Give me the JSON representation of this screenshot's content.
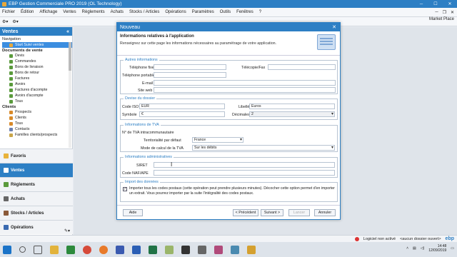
{
  "app": {
    "title": "EBP Gestion Commerciale PRO 2019 (OL Technology)",
    "market": "Market Place"
  },
  "menu": [
    "Fichier",
    "Édition",
    "Affichage",
    "Ventes",
    "Règlements",
    "Achats",
    "Stocks / Articles",
    "Opérations",
    "Paramètres",
    "Outils",
    "Fenêtres",
    "?"
  ],
  "sidebar": {
    "header": "Ventes",
    "navigation_label": "Navigation",
    "selected": "Start Suivi ventes",
    "group1": "Documents de vente",
    "docs": [
      "Devis",
      "Commandes",
      "Bons de livraison",
      "Bons de retour",
      "Factures",
      "Avoirs",
      "Factures d'acompte",
      "Avoirs d'acompte",
      "Tous"
    ],
    "group2": "Clients",
    "clients": [
      "Prospects",
      "Clients",
      "Tous",
      "Contacts",
      "Familles clients/prospects"
    ],
    "modules": [
      "Favoris",
      "Ventes",
      "Règlements",
      "Achats",
      "Stocks / Articles",
      "Opérations"
    ]
  },
  "dialog": {
    "title": "Nouveau",
    "heading": "Informations relatives à l'application",
    "subtitle": "Renseignez sur cette page les informations nécessaires au paramétrage de votre application.",
    "autres": {
      "legend": "Autres informations",
      "tel_fixe": "Téléphone fixe",
      "telecopie": "Télécopie/Fax",
      "tel_portable": "Téléphone portable",
      "email": "E-mail",
      "site": "Site web"
    },
    "devise": {
      "legend": "Devise du dossier",
      "code_label": "Code ISO",
      "code_value": "EUR",
      "libelle_label": "Libellé",
      "libelle_value": "Euros",
      "symbole_label": "Symbole",
      "symbole_value": "€",
      "decimales_label": "Décimales",
      "decimales_value": "2"
    },
    "tva": {
      "legend": "Informations de TVA",
      "intra": "N° de TVA intracommunautaire",
      "territ_label": "Territorialité par défaut",
      "territ_value": "France",
      "mode_label": "Mode de calcul de la TVA",
      "mode_value": "Sur les débits"
    },
    "admin": {
      "legend": "Informations administratives",
      "siret": "SIRET",
      "naf": "Code NAF/APE"
    },
    "import": {
      "legend": "Import des données",
      "text": "Importer tous les codes postaux (cette opération peut prendre plusieurs minutes). Décocher cette option permet d'en importer un extrait. Vous pourrez importer par la suite l'intégralité des codes postaux."
    },
    "buttons": {
      "help": "Aide",
      "prev": "< Précédent",
      "next": "Suivant >",
      "launch": "Lancer",
      "cancel": "Annuler"
    }
  },
  "status": {
    "license": "Logiciel non activé",
    "dossier": "<aucun dossier ouvert>",
    "brand": "ebp"
  },
  "taskbar": {
    "time": "14:48",
    "date": "12/09/2019"
  }
}
